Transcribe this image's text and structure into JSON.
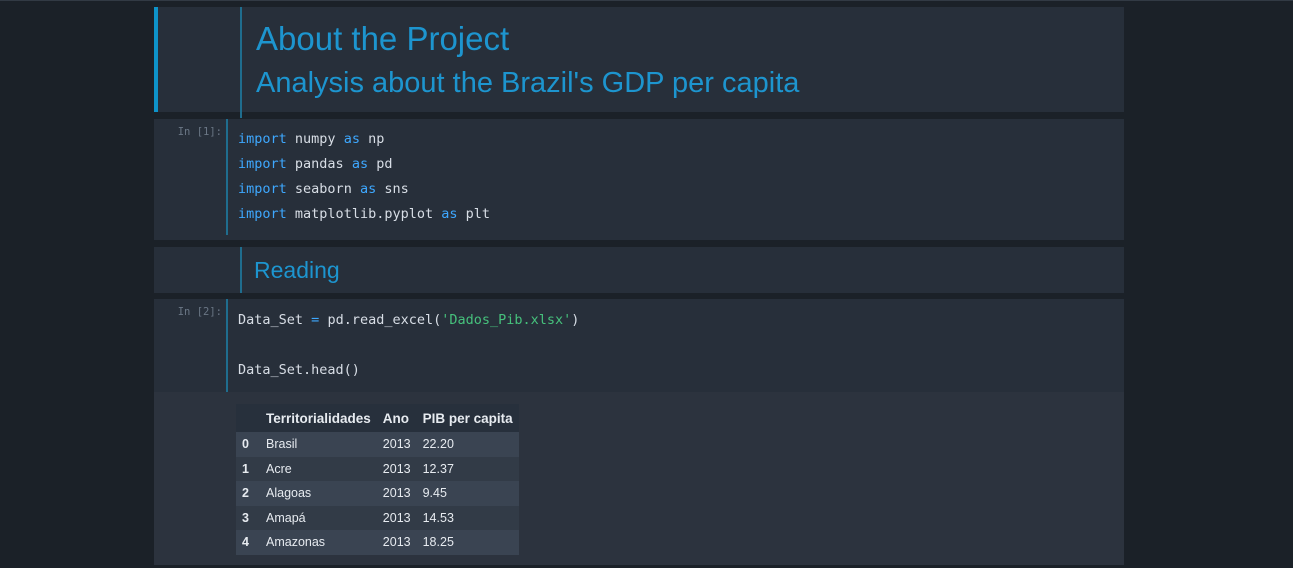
{
  "cells": {
    "title": {
      "heading": "About the Project",
      "subheading": "Analysis about the Brazil's GDP per capita"
    },
    "imports": {
      "prompt": "In [1]:",
      "lines": [
        {
          "kw": "import",
          "module": "numpy",
          "as": "as",
          "alias": "np"
        },
        {
          "kw": "import",
          "module": "pandas",
          "as": "as",
          "alias": "pd"
        },
        {
          "kw": "import",
          "module": "seaborn",
          "as": "as",
          "alias": "sns"
        },
        {
          "kw": "import",
          "module": "matplotlib.pyplot",
          "as": "as",
          "alias": "plt"
        }
      ]
    },
    "reading": {
      "heading": "Reading"
    },
    "read_cell": {
      "prompt": "In [2]:",
      "line1_var": "Data_Set",
      "line1_op": "=",
      "line1_call": "pd.read_excel(",
      "line1_str": "'Dados_Pib.xlsx'",
      "line1_close": ")",
      "line3": "Data_Set.head()"
    }
  },
  "dataframe": {
    "columns": [
      "",
      "Territorialidades",
      "Ano",
      "PIB per capita"
    ],
    "rows": [
      {
        "index": "0",
        "territorialidade": "Brasil",
        "ano": "2013",
        "pib": "22.20"
      },
      {
        "index": "1",
        "territorialidade": "Acre",
        "ano": "2013",
        "pib": "12.37"
      },
      {
        "index": "2",
        "territorialidade": "Alagoas",
        "ano": "2013",
        "pib": "9.45"
      },
      {
        "index": "3",
        "territorialidade": "Amapá",
        "ano": "2013",
        "pib": "14.53"
      },
      {
        "index": "4",
        "territorialidade": "Amazonas",
        "ano": "2013",
        "pib": "18.25"
      }
    ]
  },
  "colors": {
    "accent": "#0e93c9",
    "heading": "#1d95cf",
    "keyword": "#3ea8ff",
    "string": "#46c17c"
  }
}
